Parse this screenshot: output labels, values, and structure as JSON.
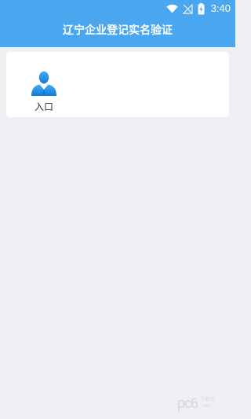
{
  "status_bar": {
    "time": "3:40",
    "icons": [
      "wifi-icon",
      "no-signal-icon",
      "battery-charging-icon"
    ]
  },
  "header": {
    "title": "辽宁企业登记实名验证"
  },
  "entry": {
    "label": "入口",
    "icon": "user-icon"
  },
  "watermark": {
    "text": "pc6",
    "sub_top": "下载站",
    "sub_bottom": ".com"
  },
  "colors": {
    "app_bar": "#4aa6ee",
    "background": "#efeff4",
    "card": "#ffffff",
    "icon_blue": "#1f8de0"
  }
}
